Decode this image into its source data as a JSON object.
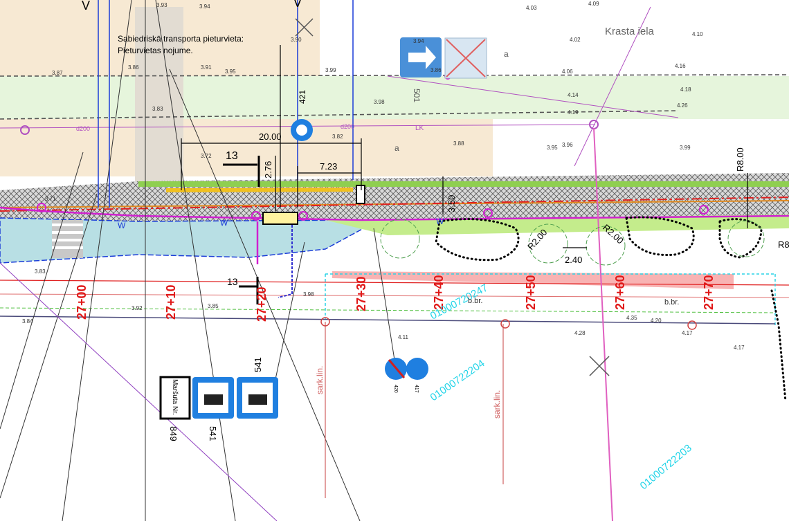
{
  "street_name": "Krasta iela",
  "stop_note": {
    "line1": "Sabiedriskā transporta pieturvieta:",
    "line2": "Pieturvietas nojume."
  },
  "dimensions": {
    "d_20": "20.00",
    "d_723": "7.23",
    "d_276": "2.76",
    "d_350": "3.50",
    "d_240": "2.40",
    "r1": "R2.00",
    "r2": "R2.00",
    "r3": "R8.00",
    "r4": "R8",
    "markers_13": [
      "13",
      "13"
    ]
  },
  "chainage": [
    "27+00",
    "27+10",
    "27+20",
    "27+30",
    "27+40",
    "27+50",
    "27+60",
    "27+70"
  ],
  "parcels": [
    "01000720247",
    "01000722204",
    "01000722203"
  ],
  "red_line_labels": [
    "sark.lin.",
    "sark.lin."
  ],
  "small_labels": {
    "d200": "d200",
    "lk": "LK",
    "a": "a",
    "v": "V",
    "w": "W",
    "bbr": "b.br.",
    "n421": "421",
    "n501": "501",
    "n420": "420",
    "n417": "417"
  },
  "signs": {
    "route_label": "Maršuta Nr.",
    "route_number": "849",
    "sign_541a": "541",
    "sign_541b": "541"
  },
  "elevations": [
    "3.94",
    "3.87",
    "3.93",
    "3.91",
    "3.99",
    "3.94",
    "3.86",
    "3.82",
    "3.84",
    "3.95",
    "4.03",
    "4.09",
    "4.02",
    "4.10",
    "4.06",
    "4.14",
    "4.16",
    "4.18",
    "4.17",
    "3.99",
    "3.88",
    "3.86",
    "3.98",
    "4.11",
    "3.90",
    "3.71",
    "3.83",
    "3.85",
    "4.19",
    "3.96",
    "4.26",
    "3.83",
    "3.92",
    "3.98",
    "4.35",
    "4.28",
    "4.20",
    "3.72",
    "3.95",
    "4.17"
  ],
  "colors": {
    "background": "#ffffff",
    "building_tan": "#f7e9d3",
    "green_strip": "#e6f5dc",
    "lawn": "#c4ec8c",
    "bus_lane": "#b8dfe4",
    "cross_hatch": "#7a7a7a",
    "magenta": "#d020d0",
    "red": "#e02020",
    "blue_line": "#1a3cd8",
    "sign_blue": "#1f7fe0",
    "cyan": "#2ad4e6"
  }
}
